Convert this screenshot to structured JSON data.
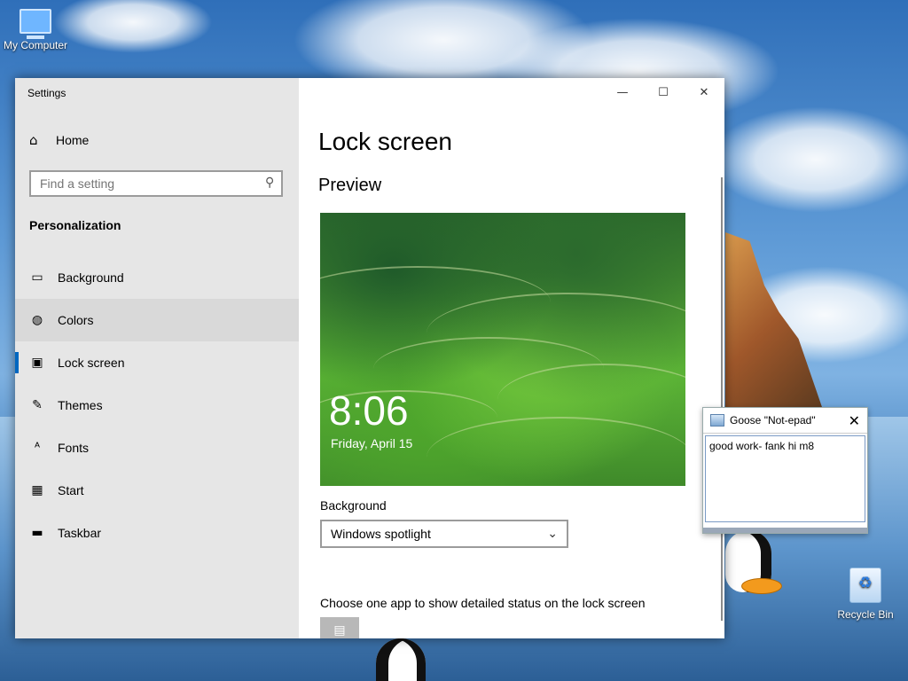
{
  "desktop": {
    "icons": [
      {
        "label": "My Computer"
      },
      {
        "label": "Recycle Bin"
      }
    ]
  },
  "settings": {
    "window_title": "Settings",
    "home_label": "Home",
    "search_placeholder": "Find a setting",
    "section_label": "Personalization",
    "nav": [
      {
        "label": "Background",
        "icon": "image-icon"
      },
      {
        "label": "Colors",
        "icon": "palette-icon"
      },
      {
        "label": "Lock screen",
        "icon": "lock-screen-icon"
      },
      {
        "label": "Themes",
        "icon": "themes-icon"
      },
      {
        "label": "Fonts",
        "icon": "fonts-icon"
      },
      {
        "label": "Start",
        "icon": "start-icon"
      },
      {
        "label": "Taskbar",
        "icon": "taskbar-icon"
      }
    ],
    "page_title": "Lock screen",
    "preview_label": "Preview",
    "preview_time": "8:06",
    "preview_date": "Friday, April 15",
    "background_label": "Background",
    "background_value": "Windows spotlight",
    "status_label": "Choose one app to show detailed status on the lock screen"
  },
  "notepad": {
    "title": "Goose \"Not-epad\"",
    "body": "good work- fank hi m8"
  },
  "colors": {
    "accent": "#0067c0",
    "sidebar_bg": "#e6e6e6"
  }
}
